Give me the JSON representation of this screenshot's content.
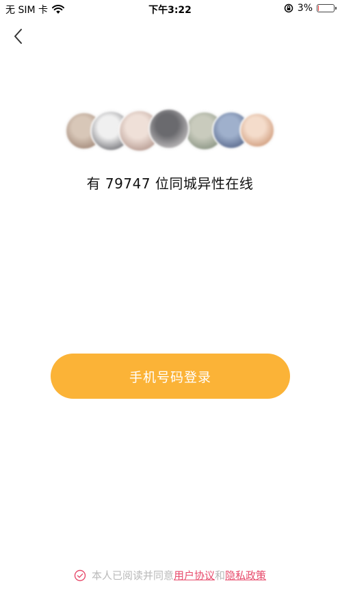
{
  "status_bar": {
    "carrier": "无 SIM 卡",
    "time": "下午3:22",
    "battery_percent": "3%",
    "battery_level": 0.03
  },
  "main": {
    "online_text": "有 79747 位同城异性在线",
    "login_button_label": "手机号码登录"
  },
  "avatars": [
    {
      "color_a": "#d8c7b8",
      "color_b": "#8a6e5e"
    },
    {
      "color_a": "#f0f0f0",
      "color_b": "#3d3d44"
    },
    {
      "color_a": "#efe0d8",
      "color_b": "#9c7a70"
    },
    {
      "color_a": "#6a6a6e",
      "color_b": "#e6e2e2"
    },
    {
      "color_a": "#c9cbbd",
      "color_b": "#6e7c6a"
    },
    {
      "color_a": "#9fb0cc",
      "color_b": "#3a4a70"
    },
    {
      "color_a": "#f4dccb",
      "color_b": "#c0805a"
    }
  ],
  "agreement": {
    "prefix": "本人已阅读并同意",
    "user_agreement": "用户协议",
    "and": "和",
    "privacy_policy": "隐私政策"
  },
  "colors": {
    "accent": "#fbb337",
    "link": "#e74a6b",
    "muted": "#b9b9b9"
  }
}
